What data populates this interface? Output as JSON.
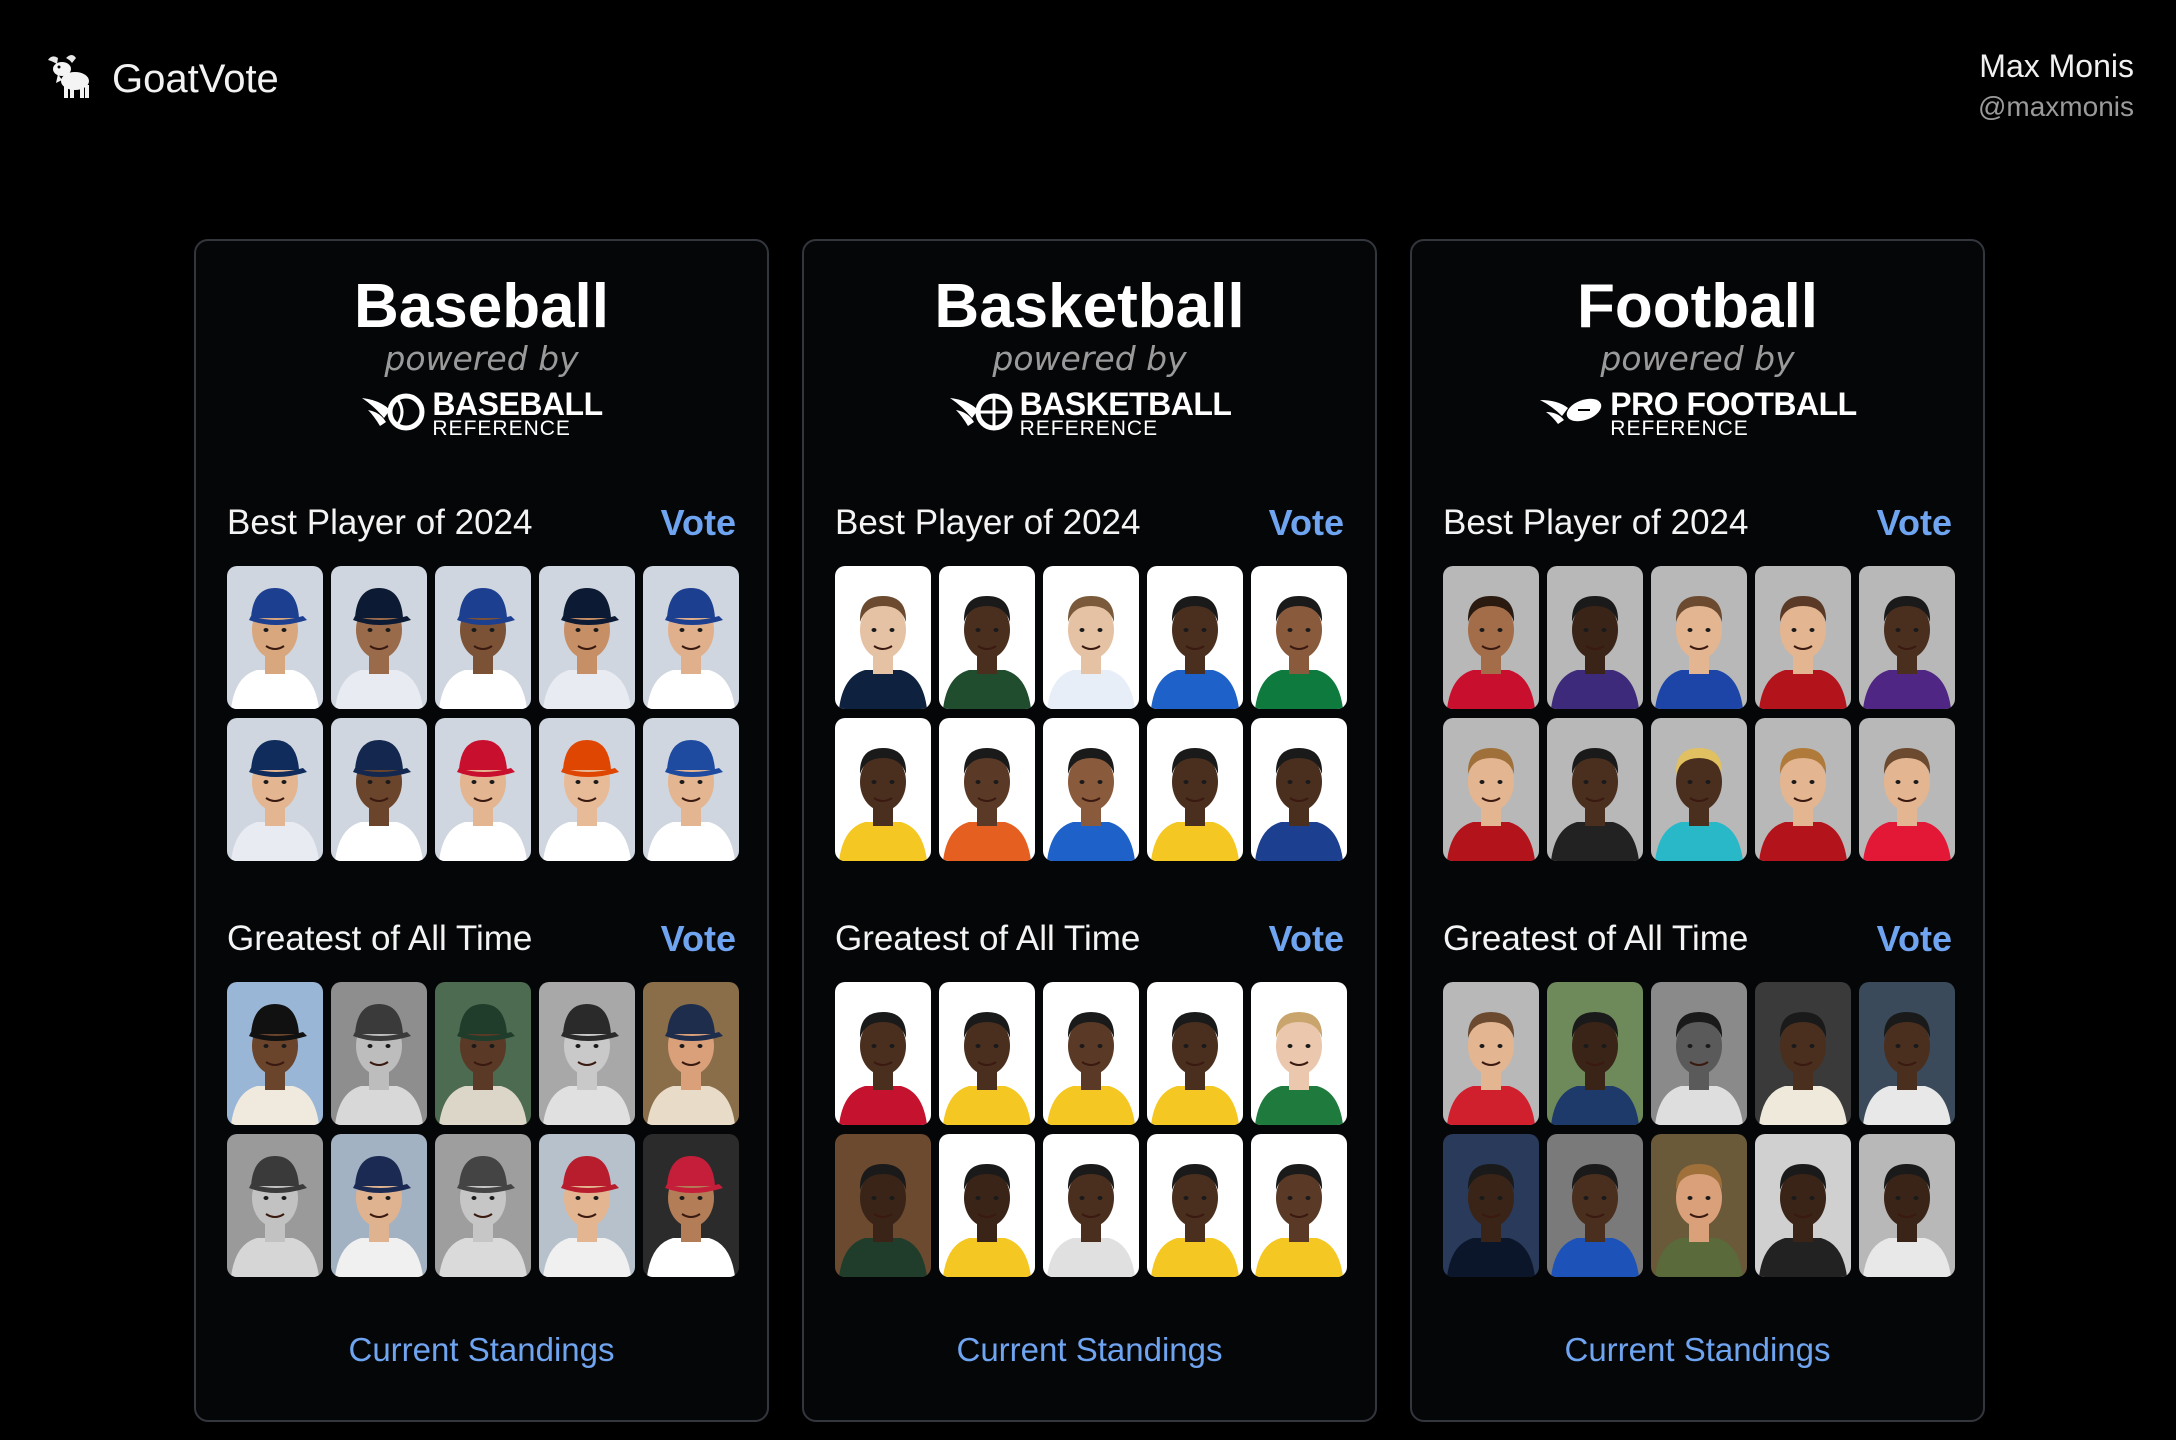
{
  "app": {
    "name": "GoatVote",
    "logo_icon": "goat-icon"
  },
  "user": {
    "name": "Max Monis",
    "handle": "@maxmonis"
  },
  "sports": [
    {
      "title": "Baseball",
      "powered_by": "powered by",
      "reference": {
        "main": "BASEBALL",
        "sub": "REFERENCE",
        "icon": "baseball-reference-icon"
      },
      "sections": [
        {
          "title": "Best Player of 2024",
          "vote_label": "Vote",
          "players": [
            {
              "bg": "#cfd6df",
              "jersey": "#ffffff",
              "cap": "#1d3f8f",
              "skin": "#d9a77d",
              "hair": "#1d3f8f"
            },
            {
              "bg": "#cfd6df",
              "jersey": "#e8ecf2",
              "cap": "#0c1a33",
              "skin": "#9a6b4b",
              "hair": "#0c1a33"
            },
            {
              "bg": "#cfd6df",
              "jersey": "#ffffff",
              "cap": "#1d3f8f",
              "skin": "#7b5236",
              "hair": "#1d3f8f"
            },
            {
              "bg": "#cfd6df",
              "jersey": "#e8ecf2",
              "cap": "#0c1a33",
              "skin": "#c78f66",
              "hair": "#0c1a33"
            },
            {
              "bg": "#cfd6df",
              "jersey": "#ffffff",
              "cap": "#1d3f8f",
              "skin": "#e0b08c",
              "hair": "#1d3f8f"
            },
            {
              "bg": "#cfd6df",
              "jersey": "#e8ecf2",
              "cap": "#0f2c5c",
              "skin": "#e3b590",
              "hair": "#0f2c5c"
            },
            {
              "bg": "#cfd6df",
              "jersey": "#ffffff",
              "cap": "#13274f",
              "skin": "#6b442c",
              "hair": "#13274f"
            },
            {
              "bg": "#cfd6df",
              "jersey": "#ffffff",
              "cap": "#c8102e",
              "skin": "#e3b590",
              "hair": "#c8102e"
            },
            {
              "bg": "#cfd6df",
              "jersey": "#ffffff",
              "cap": "#df4601",
              "skin": "#e8bb98",
              "hair": "#ffffff"
            },
            {
              "bg": "#cfd6df",
              "jersey": "#ffffff",
              "cap": "#1e4ba0",
              "skin": "#e3b590",
              "hair": "#1e4ba0"
            }
          ]
        },
        {
          "title": "Greatest of All Time",
          "vote_label": "Vote",
          "players": [
            {
              "bg": "#9ab6d6",
              "jersey": "#f0e9de",
              "cap": "#111111",
              "skin": "#6b442c",
              "hair": "#111111"
            },
            {
              "bg": "#8e8e8e",
              "jersey": "#d8d8d8",
              "cap": "#3a3a3a",
              "skin": "#bdbdbd",
              "hair": "#3a3a3a"
            },
            {
              "bg": "#4d6b50",
              "jersey": "#dcd6c8",
              "cap": "#1f3d2a",
              "skin": "#5a3a26",
              "hair": "#1f3d2a"
            },
            {
              "bg": "#a8a8a8",
              "jersey": "#e0e0e0",
              "cap": "#2a2a2a",
              "skin": "#c9c9c9",
              "hair": "#2a2a2a"
            },
            {
              "bg": "#8a6e4a",
              "jersey": "#e8dcc8",
              "cap": "#1f2d4d",
              "skin": "#d9a07a",
              "hair": "#1f2d4d"
            },
            {
              "bg": "#9a9a9a",
              "jersey": "#d6d6d6",
              "cap": "#3a3a3a",
              "skin": "#c2c2c2",
              "hair": "#3a3a3a"
            },
            {
              "bg": "#a2b2c2",
              "jersey": "#f0f0f0",
              "cap": "#1b2a52",
              "skin": "#e0b390",
              "hair": "#1b2a52"
            },
            {
              "bg": "#9e9e9e",
              "jersey": "#dadada",
              "cap": "#444444",
              "skin": "#c6c6c6",
              "hair": "#444444"
            },
            {
              "bg": "#b7c1cc",
              "jersey": "#f0f0f0",
              "cap": "#b81d2e",
              "skin": "#e3b590",
              "hair": "#b81d2e"
            },
            {
              "bg": "#2b2b2b",
              "jersey": "#ffffff",
              "cap": "#c41e3a",
              "skin": "#b27d57",
              "hair": "#c41e3a"
            }
          ]
        }
      ],
      "standings_label": "Current Standings"
    },
    {
      "title": "Basketball",
      "powered_by": "powered by",
      "reference": {
        "main": "BASKETBALL",
        "sub": "REFERENCE",
        "icon": "basketball-reference-icon"
      },
      "sections": [
        {
          "title": "Best Player of 2024",
          "vote_label": "Vote",
          "players": [
            {
              "bg": "#ffffff",
              "jersey": "#0e2240",
              "cap": "",
              "skin": "#e6c2a4",
              "hair": "#6b4a30"
            },
            {
              "bg": "#ffffff",
              "jersey": "#1f4d2e",
              "cap": "",
              "skin": "#4a2f1f",
              "hair": "#1a1a1a"
            },
            {
              "bg": "#ffffff",
              "jersey": "#e8eef7",
              "cap": "",
              "skin": "#e6c2a4",
              "hair": "#7a5a3a"
            },
            {
              "bg": "#ffffff",
              "jersey": "#1d61c9",
              "cap": "",
              "skin": "#4a2f1f",
              "hair": "#1a1a1a"
            },
            {
              "bg": "#ffffff",
              "jersey": "#0f7a3e",
              "cap": "",
              "skin": "#8a5a3c",
              "hair": "#1a1a1a"
            },
            {
              "bg": "#ffffff",
              "jersey": "#f5c722",
              "cap": "",
              "skin": "#4a2f1f",
              "hair": "#1a1a1a"
            },
            {
              "bg": "#ffffff",
              "jersey": "#e56020",
              "cap": "",
              "skin": "#5a3a26",
              "hair": "#1a1a1a"
            },
            {
              "bg": "#ffffff",
              "jersey": "#1d61c9",
              "cap": "",
              "skin": "#8a5a3c",
              "hair": "#1a1a1a"
            },
            {
              "bg": "#ffffff",
              "jersey": "#f5c722",
              "cap": "",
              "skin": "#4a2f1f",
              "hair": "#1a1a1a"
            },
            {
              "bg": "#ffffff",
              "jersey": "#1d3f8f",
              "cap": "",
              "skin": "#4a2f1f",
              "hair": "#1a1a1a"
            }
          ]
        },
        {
          "title": "Greatest of All Time",
          "vote_label": "Vote",
          "players": [
            {
              "bg": "#ffffff",
              "jersey": "#c4122f",
              "cap": "",
              "skin": "#4a2f1f",
              "hair": "#1a1a1a"
            },
            {
              "bg": "#ffffff",
              "jersey": "#f5c722",
              "cap": "",
              "skin": "#4a2f1f",
              "hair": "#1a1a1a"
            },
            {
              "bg": "#ffffff",
              "jersey": "#f5c722",
              "cap": "",
              "skin": "#5a3a26",
              "hair": "#1a1a1a"
            },
            {
              "bg": "#ffffff",
              "jersey": "#f5c722",
              "cap": "",
              "skin": "#4a2f1f",
              "hair": "#1a1a1a"
            },
            {
              "bg": "#ffffff",
              "jersey": "#1f7a3e",
              "cap": "",
              "skin": "#eac7ad",
              "hair": "#c9a46c"
            },
            {
              "bg": "#6b4a30",
              "jersey": "#1f3d2a",
              "cap": "",
              "skin": "#3a2418",
              "hair": "#1a1a1a"
            },
            {
              "bg": "#ffffff",
              "jersey": "#f5c722",
              "cap": "",
              "skin": "#3a2418",
              "hair": "#1a1a1a"
            },
            {
              "bg": "#ffffff",
              "jersey": "#e0e0e0",
              "cap": "",
              "skin": "#4a2f1f",
              "hair": "#1a1a1a"
            },
            {
              "bg": "#ffffff",
              "jersey": "#f5c722",
              "cap": "",
              "skin": "#4a2f1f",
              "hair": "#1a1a1a"
            },
            {
              "bg": "#ffffff",
              "jersey": "#f5c722",
              "cap": "",
              "skin": "#5a3a26",
              "hair": "#1a1a1a"
            }
          ]
        }
      ],
      "standings_label": "Current Standings"
    },
    {
      "title": "Football",
      "powered_by": "powered by",
      "reference": {
        "main": "PRO FOOTBALL",
        "sub": "REFERENCE",
        "icon": "pro-football-reference-icon"
      },
      "sections": [
        {
          "title": "Best Player of 2024",
          "vote_label": "Vote",
          "players": [
            {
              "bg": "#b8b8b8",
              "jersey": "#c8102e",
              "cap": "",
              "skin": "#a36d4a",
              "hair": "#2a1a10"
            },
            {
              "bg": "#b8b8b8",
              "jersey": "#3d2a7a",
              "cap": "",
              "skin": "#3a2418",
              "hair": "#1a1a1a"
            },
            {
              "bg": "#b8b8b8",
              "jersey": "#1d45a8",
              "cap": "",
              "skin": "#e3b590",
              "hair": "#6b4a30"
            },
            {
              "bg": "#b8b8b8",
              "jersey": "#b3131b",
              "cap": "",
              "skin": "#e3b590",
              "hair": "#5a3a26"
            },
            {
              "bg": "#b8b8b8",
              "jersey": "#4f2683",
              "cap": "",
              "skin": "#4a2f1f",
              "hair": "#1a1a1a"
            },
            {
              "bg": "#b8b8b8",
              "jersey": "#b3131b",
              "cap": "",
              "skin": "#e3b590",
              "hair": "#a0703a"
            },
            {
              "bg": "#b8b8b8",
              "jersey": "#222222",
              "cap": "",
              "skin": "#4a2f1f",
              "hair": "#1a1a1a"
            },
            {
              "bg": "#b8b8b8",
              "jersey": "#28b8c8",
              "cap": "",
              "skin": "#4a2f1f",
              "hair": "#e0c060"
            },
            {
              "bg": "#b8b8b8",
              "jersey": "#b3131b",
              "cap": "",
              "skin": "#e3b590",
              "hair": "#b07a3a"
            },
            {
              "bg": "#b8b8b8",
              "jersey": "#e31837",
              "cap": "",
              "skin": "#e3b590",
              "hair": "#6b4a30"
            }
          ]
        },
        {
          "title": "Greatest of All Time",
          "vote_label": "Vote",
          "players": [
            {
              "bg": "#b8b8b8",
              "jersey": "#d0202e",
              "cap": "",
              "skin": "#e3b590",
              "hair": "#6b4a30"
            },
            {
              "bg": "#6e8a5a",
              "jersey": "#1e3a6a",
              "cap": "",
              "skin": "#3a2418",
              "hair": "#1a1a1a"
            },
            {
              "bg": "#8a8a8a",
              "jersey": "#dedede",
              "cap": "",
              "skin": "#5a5a5a",
              "hair": "#1a1a1a"
            },
            {
              "bg": "#3a3a3a",
              "jersey": "#efe9dc",
              "cap": "",
              "skin": "#4a2f1f",
              "hair": "#1a1a1a"
            },
            {
              "bg": "#3a4a5a",
              "jersey": "#e8e8e8",
              "cap": "",
              "skin": "#4a2f1f",
              "hair": "#1a1a1a"
            },
            {
              "bg": "#2a3a5a",
              "jersey": "#0b162a",
              "cap": "",
              "skin": "#3a2418",
              "hair": "#1a1a1a"
            },
            {
              "bg": "#7a7a7a",
              "jersey": "#1d52b8",
              "cap": "",
              "skin": "#4a2f1f",
              "hair": "#1a1a1a"
            },
            {
              "bg": "#6a5a3a",
              "jersey": "#5a6a3a",
              "cap": "",
              "skin": "#d9a07a",
              "hair": "#a0703a"
            },
            {
              "bg": "#d0d0d0",
              "jersey": "#222222",
              "cap": "",
              "skin": "#3a2418",
              "hair": "#1a1a1a"
            },
            {
              "bg": "#b8b8b8",
              "jersey": "#e8e8e8",
              "cap": "",
              "skin": "#3a2418",
              "hair": "#1a1a1a"
            }
          ]
        }
      ],
      "standings_label": "Current Standings"
    }
  ],
  "colors": {
    "background": "#000000",
    "card_border": "#33363d",
    "accent": "#6fa4f0",
    "muted": "#9a9a9a"
  }
}
